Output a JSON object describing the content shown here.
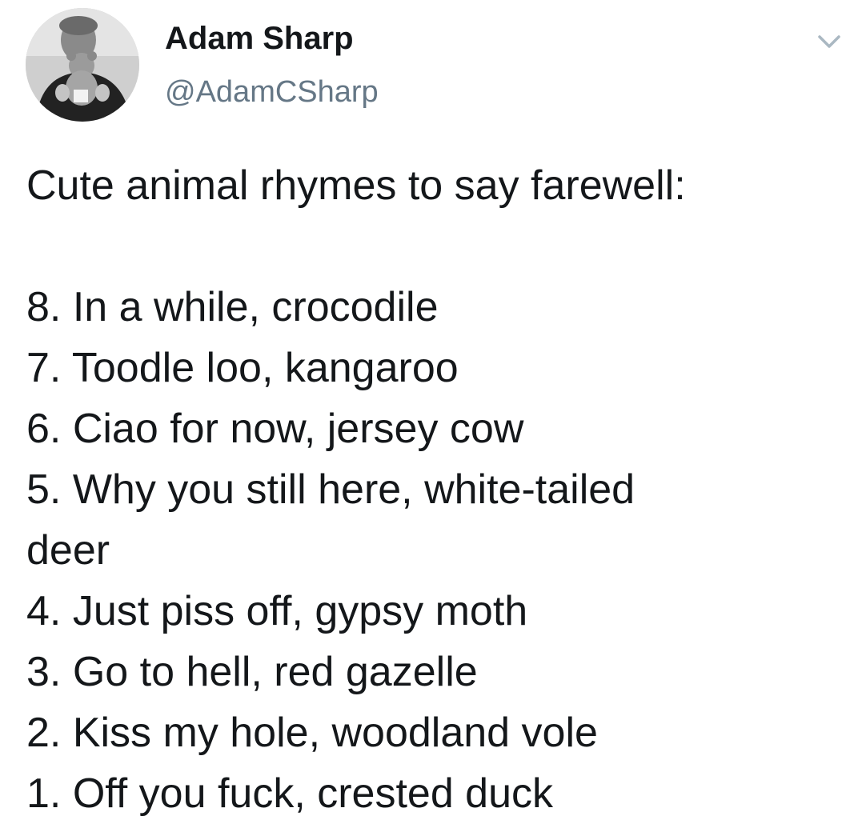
{
  "author": {
    "display_name": "Adam Sharp",
    "handle": "@AdamCSharp",
    "avatar_icon": "profile-photo",
    "caret_icon": "chevron-down-icon"
  },
  "tweet": {
    "intro": "Cute animal rhymes to say farewell:",
    "items": [
      "8. In a while, crocodile",
      "7. Toodle loo, kangaroo",
      "6. Ciao for now, jersey cow",
      "5. Why you still here, white-tailed",
      "deer",
      "4. Just piss off, gypsy moth",
      "3. Go to hell, red gazelle",
      "2. Kiss my hole, woodland vole",
      "1. Off you fuck, crested duck"
    ]
  },
  "colors": {
    "text": "#14171a",
    "secondary": "#657786",
    "caret": "#aab8c2"
  }
}
